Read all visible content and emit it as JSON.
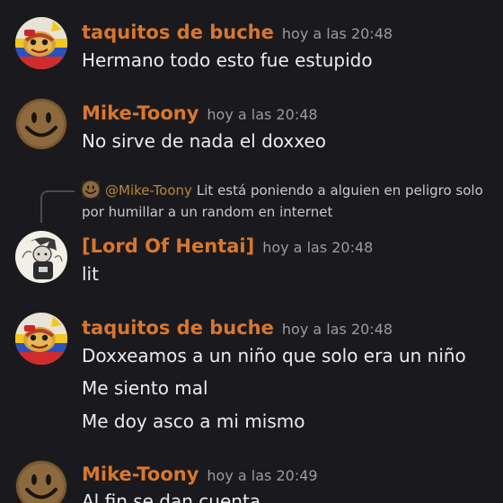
{
  "messages": [
    {
      "username": "taquitos de buche",
      "username_color": "#d9772e",
      "timestamp": "hoy a las 20:48",
      "avatar": "taquito-avatar",
      "lines": [
        "Hermano todo esto fue estupido"
      ]
    },
    {
      "username": "Mike-Toony",
      "username_color": "#d9772e",
      "timestamp": "hoy a las 20:48",
      "avatar": "smiley-avatar",
      "lines": [
        "No sirve de nada el doxxeo"
      ]
    },
    {
      "username": "[Lord Of Hentai]",
      "username_color": "#d9772e",
      "timestamp": "hoy a las 20:48",
      "avatar": "sketch-avatar",
      "reply": {
        "mention": "@Mike-Toony",
        "text_line1": "Lit está poniendo a alguien en peligro solo",
        "text_line2": "por humillar a un random en internet"
      },
      "lines": [
        "lit"
      ]
    },
    {
      "username": "taquitos de buche",
      "username_color": "#d9772e",
      "timestamp": "hoy a las 20:48",
      "avatar": "taquito-avatar",
      "lines": [
        "Doxxeamos a un niño que solo era un niño",
        "Me siento mal",
        "Me doy asco a mi mismo"
      ]
    },
    {
      "username": "Mike-Toony",
      "username_color": "#d9772e",
      "timestamp": "hoy a las 20:49",
      "avatar": "smiley-avatar",
      "lines": [
        "Al fin se dan cuenta"
      ]
    }
  ]
}
